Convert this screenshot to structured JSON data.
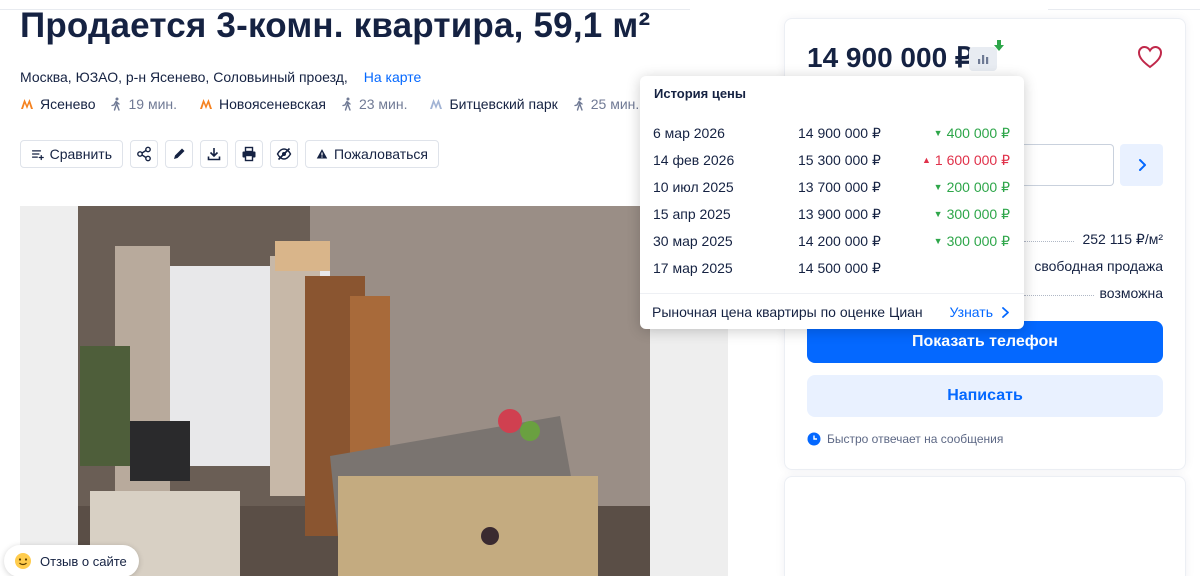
{
  "title": "Продается 3-комн. квартира, 59,1 м²",
  "address": "Москва, ЮЗАО, р-н Ясенево, Соловьиный проезд,",
  "map_link": "На карте",
  "metro": [
    {
      "name": "Ясенево",
      "time": "19 мин.",
      "color": "#f58220"
    },
    {
      "name": "Новоясеневская",
      "time": "23 мин.",
      "color": "#f58220"
    },
    {
      "name": "Битцевский парк",
      "time": "25 мин.",
      "color": "#a1b3d4"
    }
  ],
  "actions": {
    "compare": "Сравнить",
    "complain": "Пожаловаться"
  },
  "price": "14 900 000 ₽",
  "price_history": {
    "title": "История цены",
    "rows": [
      {
        "date": "6 мар 2026",
        "price": "14 900 000 ₽",
        "change": "400 000 ₽",
        "direction": "down"
      },
      {
        "date": "14 фев 2026",
        "price": "15 300 000 ₽",
        "change": "1 600 000 ₽",
        "direction": "up"
      },
      {
        "date": "10 июл 2025",
        "price": "13 700 000 ₽",
        "change": "200 000 ₽",
        "direction": "down"
      },
      {
        "date": "15 апр 2025",
        "price": "13 900 000 ₽",
        "change": "300 000 ₽",
        "direction": "down"
      },
      {
        "date": "30 мар 2025",
        "price": "14 200 000 ₽",
        "change": "300 000 ₽",
        "direction": "down"
      },
      {
        "date": "17 мар 2025",
        "price": "14 500 000 ₽",
        "change": "",
        "direction": "none"
      }
    ],
    "market_text": "Рыночная цена квартиры по оценке Циан",
    "market_link": "Узнать"
  },
  "details": {
    "price_per_m2": "252 115 ₽/м²",
    "sale_type": "свободная продажа",
    "mortgage": "возможна"
  },
  "buttons": {
    "show_phone": "Показать телефон",
    "write": "Написать"
  },
  "reply_note": "Быстро отвечает на сообщения",
  "feedback": "Отзыв о сайте",
  "colors": {
    "accent": "#0468ff",
    "accent_light": "#e9f1ff",
    "down": "#2ea64a",
    "up": "#e0314a",
    "heart": "#c0284a"
  }
}
